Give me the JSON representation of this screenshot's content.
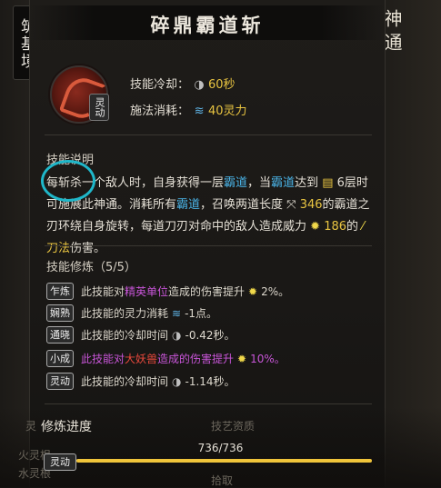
{
  "realm": "筑基境",
  "category_tag": "神通",
  "title": "碎鼎霸道斩",
  "skill_type_badge": "灵动",
  "stats": {
    "cooldown_label": "技能冷却：",
    "cooldown_value": "60秒",
    "cost_label": "施法消耗：",
    "cost_value": "40灵力"
  },
  "description": {
    "heading": "技能说明",
    "p1": "每斩杀一个敌人时，自身获得一层",
    "kw1": "霸道",
    "p2": "，当",
    "kw2": "霸道",
    "p3": "达到",
    "num1": "6层",
    "p4": "时可施展此神通。消耗所有",
    "kw3": "霸道",
    "p5": "，召唤两道长度",
    "num2": "346",
    "p6": "的霸道之刃环绕自身旋转，每道刀刃对命中的敌人造成威力",
    "num3": "186",
    "p7": "的",
    "kw4": "刀法",
    "p8": "伤害。"
  },
  "mods": {
    "heading": "技能修炼（5/5）",
    "items": [
      {
        "tag": "乍炼",
        "pre": "此技能对",
        "hl": "精英单位",
        "mid": "造成的伤害提升",
        "val": "2%。"
      },
      {
        "tag": "娴熟",
        "pre": "此技能的灵力消耗",
        "val": "-1点。"
      },
      {
        "tag": "通晓",
        "pre": "此技能的冷却时间",
        "val": "-0.42秒。"
      },
      {
        "tag": "小成",
        "pre": "此技能对",
        "hl": "大妖兽",
        "mid": "造成的伤害提升",
        "val": "10%。"
      },
      {
        "tag": "灵动",
        "pre": "此技能的冷却时间",
        "val": "-1.14秒。"
      }
    ]
  },
  "progress": {
    "label": "修炼进度",
    "count": "736/736",
    "badge": "灵动",
    "fraction": 1.0
  },
  "background_text": {
    "left_1": "灵",
    "right_1": "技艺资质",
    "left_2": "火灵根",
    "left_3": "水灵根",
    "right_2": "拾取"
  },
  "colors": {
    "keyword": "#4ab3e6",
    "value": "#e8c441",
    "elite": "#c855d8",
    "beast": "#e8483c",
    "annotation_ring": "#1fb7c9"
  }
}
